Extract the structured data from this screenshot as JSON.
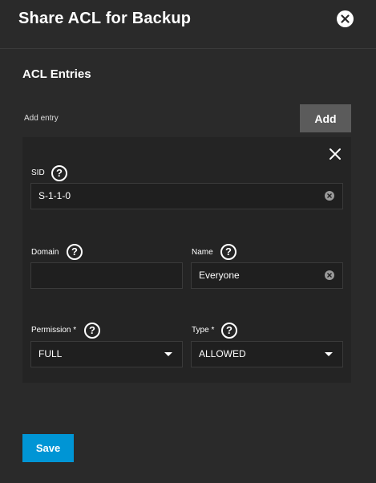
{
  "dialog": {
    "title": "Share ACL for Backup",
    "close_icon": "close-circle-icon"
  },
  "acl": {
    "section_title": "ACL Entries",
    "add_entry_label": "Add entry",
    "add_button_label": "Add",
    "entry": {
      "remove_icon": "close-icon",
      "sid": {
        "label": "SID",
        "value": "S-1-1-0"
      },
      "domain": {
        "label": "Domain",
        "value": ""
      },
      "name": {
        "label": "Name",
        "value": "Everyone"
      },
      "permission": {
        "label": "Permission *",
        "value": "FULL"
      },
      "type": {
        "label": "Type *",
        "value": "ALLOWED"
      },
      "help_glyph": "?"
    }
  },
  "footer": {
    "save_label": "Save"
  },
  "colors": {
    "background": "#2a2a2a",
    "card": "#242424",
    "input": "#1f1f1f",
    "add_button": "#5b5b5b",
    "primary": "#0095d5"
  }
}
